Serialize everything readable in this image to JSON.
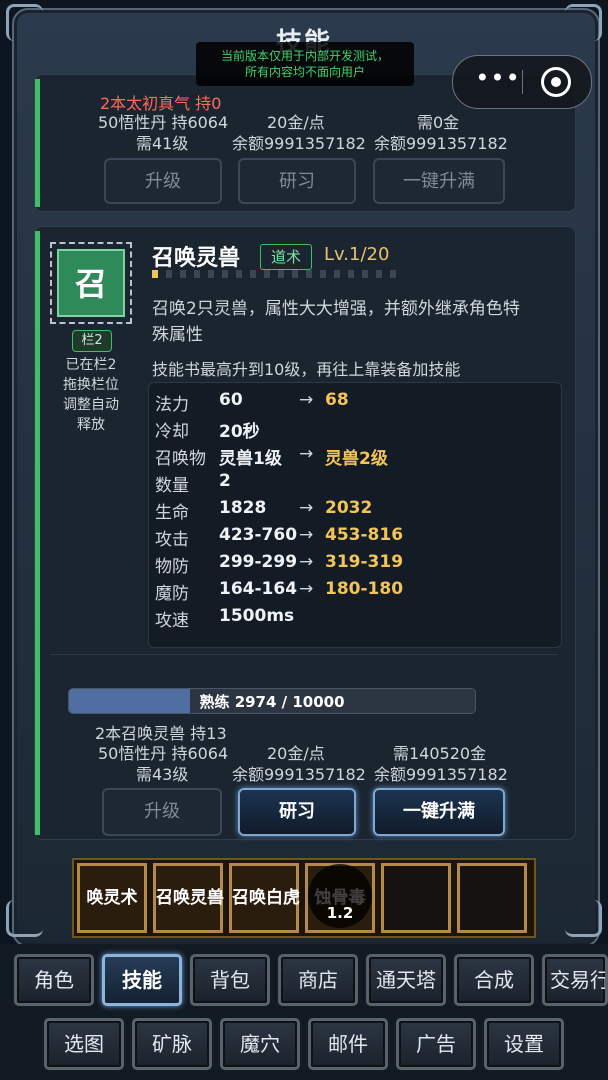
{
  "header": {
    "title": "技能",
    "notice_line1": "当前版本仅用于内部开发测试，",
    "notice_line2": "所有内容均不面向用户",
    "more_icon": "more-dots-icon",
    "close_icon": "target-close-icon"
  },
  "prev_skill": {
    "book": "2本太初真气 持0",
    "pill": "50悟性丹 持6064",
    "level_req": "需41级",
    "gold_rate": "20金/点",
    "balance1": "余额9991357182",
    "gold_need": "需0金",
    "balance2": "余额9991357182",
    "btn_upgrade": "升级",
    "btn_study": "研习",
    "btn_max": "一键升满"
  },
  "skill": {
    "icon_char": "召",
    "slot_tag": "栏2",
    "slot_note1": "已在栏2",
    "slot_note2": "拖换栏位",
    "slot_note3": "调整自动",
    "slot_note4": "释放",
    "name": "召唤灵兽",
    "type": "道术",
    "level": "Lv.1/20",
    "desc1": "召唤2只灵兽，属性大大增强，并额外继承角色特",
    "desc2": "殊属性",
    "book_note": "技能书最高升到10级，再往上靠装备加技能",
    "arrow": "→",
    "stats": [
      {
        "label": "法力",
        "cur": "60",
        "next": "68"
      },
      {
        "label": "冷却",
        "cur": "20秒",
        "next": ""
      },
      {
        "label": "召唤物",
        "cur": "灵兽1级",
        "next": "灵兽2级"
      },
      {
        "label": "数量",
        "cur": "2",
        "next": ""
      },
      {
        "label": "生命",
        "cur": "1828",
        "next": "2032"
      },
      {
        "label": "攻击",
        "cur": "423-760",
        "next": "453-816"
      },
      {
        "label": "物防",
        "cur": "299-299",
        "next": "319-319"
      },
      {
        "label": "魔防",
        "cur": "164-164",
        "next": "180-180"
      },
      {
        "label": "攻速",
        "cur": "1500ms",
        "next": ""
      }
    ],
    "proficiency_label": "熟练",
    "proficiency_value": "2974 / 10000",
    "proficiency_fraction": 0.2974,
    "book": "2本召唤灵兽 持13",
    "pill": "50悟性丹 持6064",
    "level_req": "需43级",
    "gold_rate": "20金/点",
    "balance1": "余额9991357182",
    "gold_need": "需140520金",
    "balance2": "余额9991357182",
    "btn_upgrade": "升级",
    "btn_study": "研习",
    "btn_max": "一键升满"
  },
  "skillbar": {
    "slots": [
      "唤灵术",
      "召唤灵兽",
      "召唤白虎",
      "蚀骨毒",
      "",
      ""
    ],
    "cooldown": "1.2"
  },
  "nav": {
    "row1": [
      "角色",
      "技能",
      "背包",
      "商店",
      "通天塔",
      "合成",
      "交易行"
    ],
    "row2": [
      "选图",
      "矿脉",
      "魔穴",
      "邮件",
      "广告",
      "设置"
    ]
  },
  "colors": {
    "accent_green": "#3fbf6a",
    "gold": "#f3c45a",
    "red_text": "#ff6a5a",
    "active_blue": "#8db4dd"
  }
}
